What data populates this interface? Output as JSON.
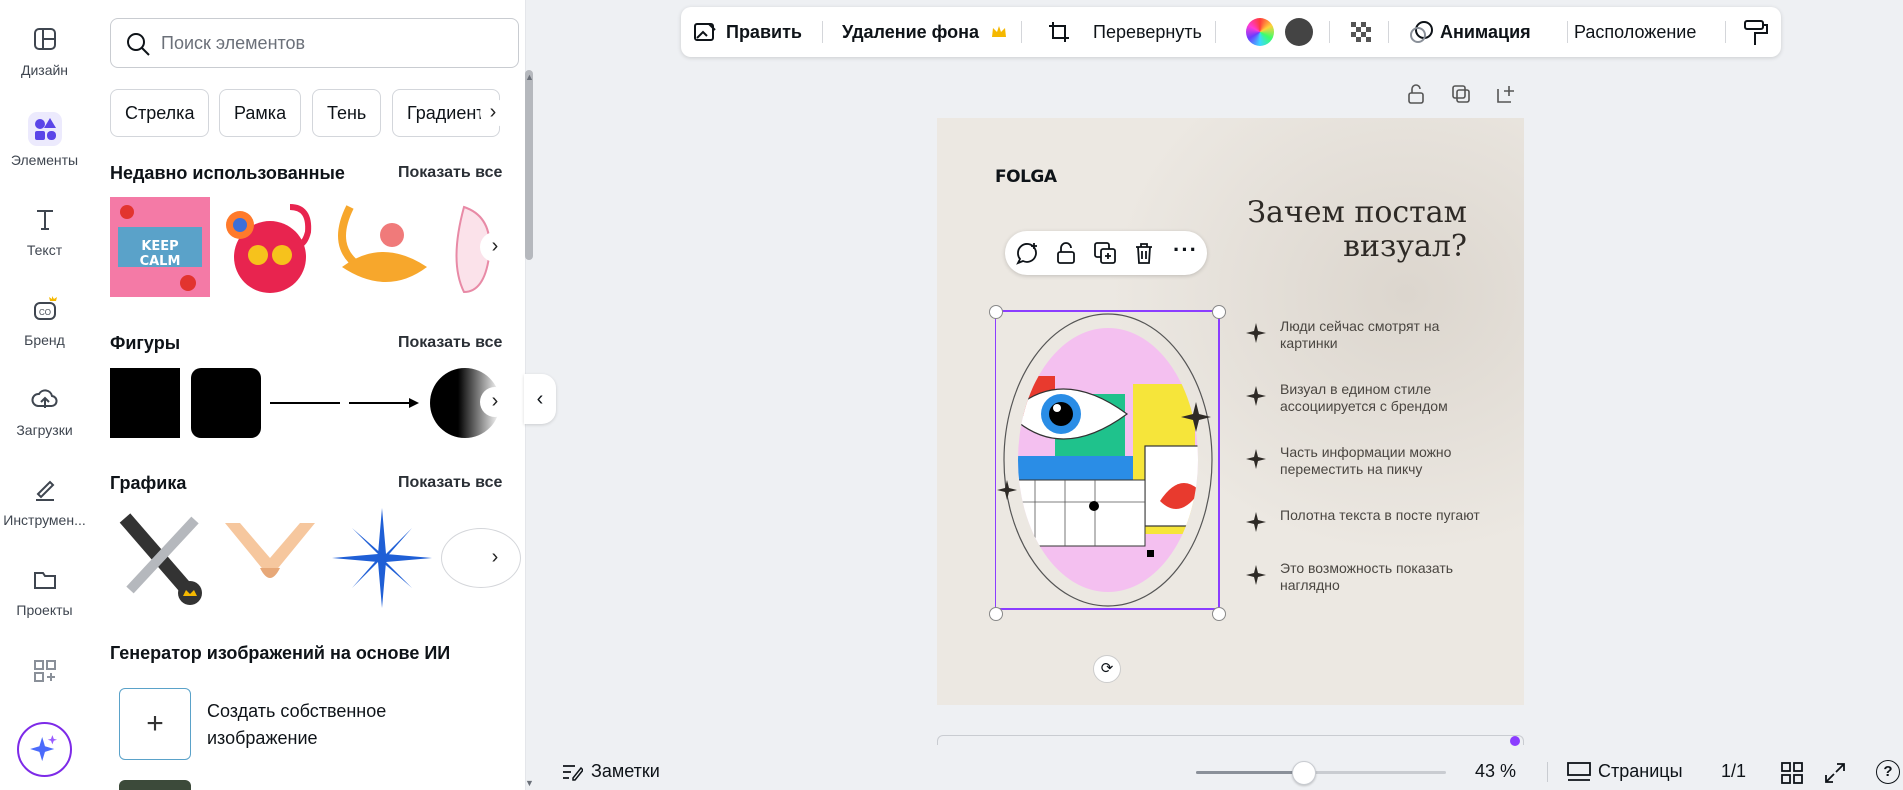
{
  "rail": [
    {
      "label": "Дизайн",
      "icon": "design-icon"
    },
    {
      "label": "Элементы",
      "icon": "elements-icon"
    },
    {
      "label": "Текст",
      "icon": "text-icon"
    },
    {
      "label": "Бренд",
      "icon": "brand-icon"
    },
    {
      "label": "Загрузки",
      "icon": "uploads-icon"
    },
    {
      "label": "Инструмен...",
      "icon": "tools-icon"
    },
    {
      "label": "Проекты",
      "icon": "projects-icon"
    }
  ],
  "search": {
    "placeholder": "Поиск элементов"
  },
  "chips": [
    "Стрелка",
    "Рамка",
    "Тень",
    "Градиент"
  ],
  "sections": {
    "recent": {
      "title": "Недавно использованные",
      "link": "Показать все"
    },
    "shapes": {
      "title": "Фигуры",
      "link": "Показать все"
    },
    "graphics": {
      "title": "Графика",
      "link": "Показать все"
    },
    "ai": {
      "title": "Генератор изображений на основе ИИ",
      "create": "Создать собственное изображение"
    }
  },
  "recent_sticker_text": "KEEP CALM",
  "toolbar": {
    "edit": "Править",
    "bg_remove": "Удаление фона",
    "flip": "Перевернуть",
    "animation": "Анимация",
    "position": "Расположение"
  },
  "design": {
    "brand": "FOLGA",
    "heading_line1": "Зачем постам",
    "heading_line2": "визуал?",
    "bullets": [
      "Люди сейчас смотрят на картинки",
      "Визуал в едином стиле ассоциируется с брендом",
      "Часть информации можно переместить на пикчу",
      "Полотна текста в посте пугают",
      "Это возможность показать наглядно"
    ]
  },
  "bottom": {
    "notes": "Заметки",
    "zoom": "43 %",
    "zoom_level": 0.43,
    "pages": "Страницы",
    "page_count": "1/1"
  },
  "colors": {
    "accent": "#8b3dff",
    "selection": "#8b3dff",
    "brand_purple": "#7d2ae8"
  }
}
